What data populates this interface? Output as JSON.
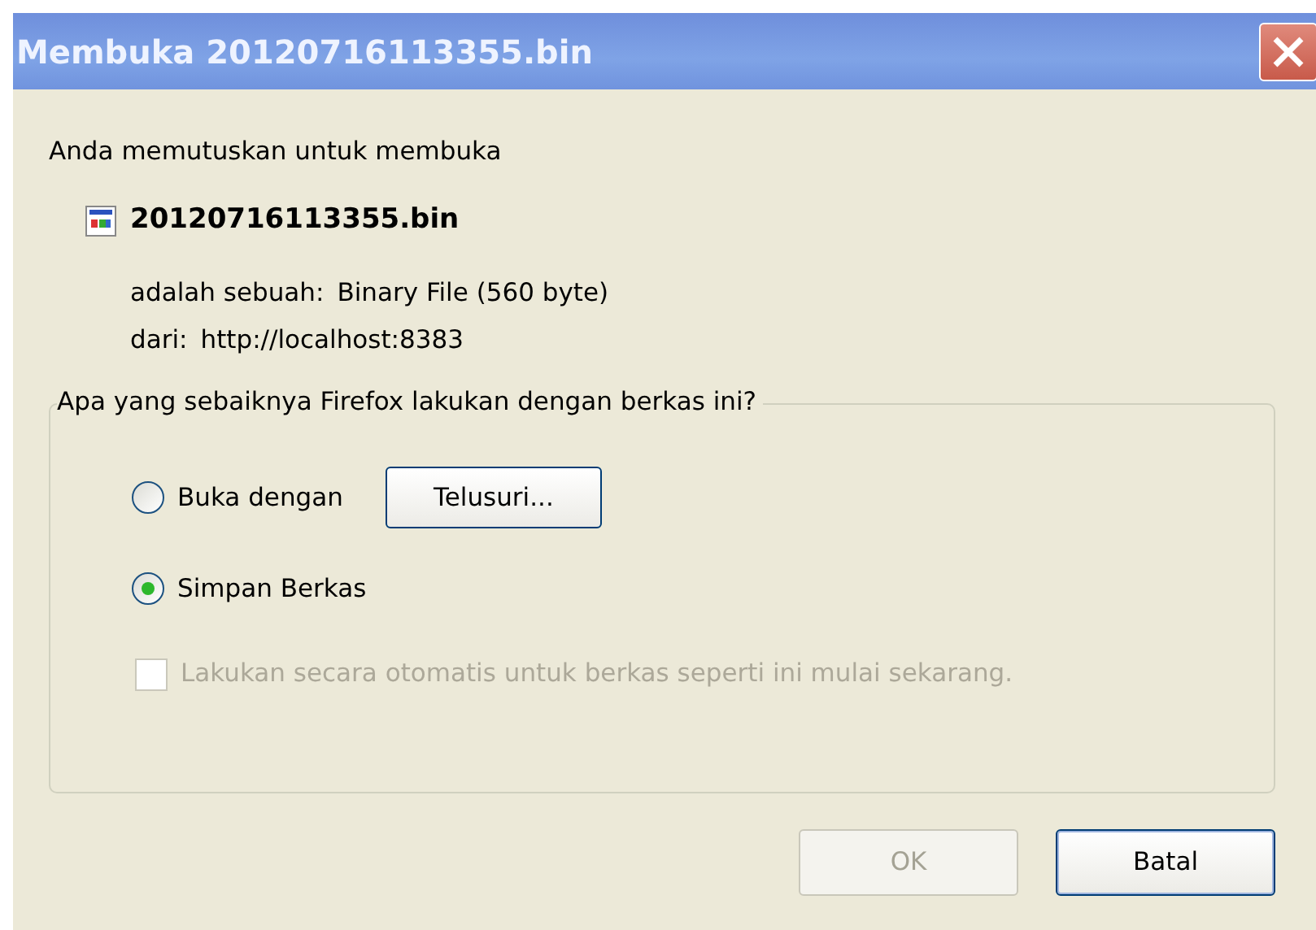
{
  "window": {
    "title": "Membuka 20120716113355.bin"
  },
  "intro": "Anda memutuskan untuk membuka",
  "file": {
    "name": "20120716113355.bin",
    "details": [
      {
        "label": "adalah sebuah:",
        "value": "Binary File (560 byte)"
      },
      {
        "label": "dari:",
        "value": "http://localhost:8383"
      }
    ]
  },
  "group": {
    "legend": "Apa yang sebaiknya Firefox lakukan dengan berkas ini?",
    "options": [
      {
        "label": "Buka dengan",
        "selected": false,
        "button": "Telusuri..."
      },
      {
        "label": "Simpan Berkas",
        "selected": true
      }
    ],
    "auto_checkbox": {
      "label": "Lakukan secara otomatis untuk berkas seperti ini mulai sekarang.",
      "checked": false,
      "disabled": true
    }
  },
  "buttons": [
    {
      "label": "OK",
      "disabled": true,
      "default": false
    },
    {
      "label": "Batal",
      "disabled": false,
      "default": true
    }
  ]
}
